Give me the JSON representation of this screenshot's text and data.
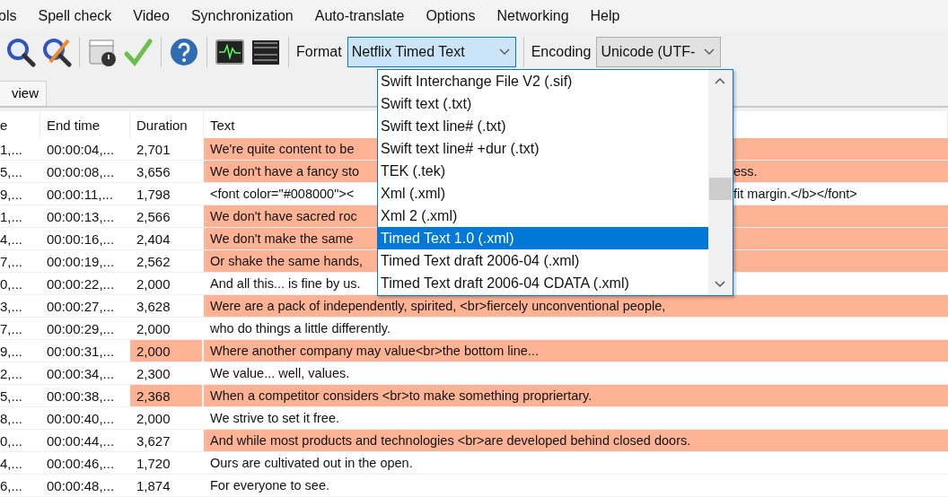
{
  "menu": [
    "ols",
    "Spell check",
    "Video",
    "Synchronization",
    "Auto-translate",
    "Options",
    "Networking",
    "Help"
  ],
  "toolbar": {
    "format_label": "Format",
    "format_value": "Netflix Timed Text",
    "encoding_label": "Encoding",
    "encoding_value": "Unicode (UTF-"
  },
  "tabs": [
    {
      "label": "view",
      "selected": true
    }
  ],
  "table": {
    "columns": [
      "e",
      "End time",
      "Duration",
      "Text"
    ],
    "rows": [
      {
        "start": "1,...",
        "end": "00:00:04,...",
        "duration": "2,701",
        "duration_flag": false,
        "text": "We're quite content to be",
        "text_continued": "",
        "flag": true
      },
      {
        "start": "5,...",
        "end": "00:00:08,...",
        "duration": "3,656",
        "duration_flag": false,
        "text": "We don't have a fancy sto",
        "text_continued": "ess.",
        "flag": true
      },
      {
        "start": "9,...",
        "end": "00:00:11,...",
        "duration": "1,798",
        "duration_flag": false,
        "text": "<font color=\"#008000\"><",
        "text_continued": "fit margin.</b></font>",
        "flag": false
      },
      {
        "start": "1,...",
        "end": "00:00:13,...",
        "duration": "2,566",
        "duration_flag": false,
        "text": "We don't have sacred roc",
        "text_continued": "",
        "flag": true
      },
      {
        "start": "4,...",
        "end": "00:00:16,...",
        "duration": "2,404",
        "duration_flag": false,
        "text": "We don't make the same",
        "text_continued": "",
        "flag": true
      },
      {
        "start": "7,...",
        "end": "00:00:19,...",
        "duration": "2,562",
        "duration_flag": false,
        "text": "Or shake the same hands,",
        "text_continued": "",
        "flag": true
      },
      {
        "start": "0,...",
        "end": "00:00:22,...",
        "duration": "2,000",
        "duration_flag": false,
        "text": "And all this... is fine by us.",
        "text_continued": "",
        "flag": false
      },
      {
        "start": "3,...",
        "end": "00:00:27,...",
        "duration": "3,628",
        "duration_flag": false,
        "text": "Were are a pack of independently, spirited, <br>fiercely unconventional people,",
        "text_continued": "",
        "flag": true
      },
      {
        "start": "7,...",
        "end": "00:00:29,...",
        "duration": "2,000",
        "duration_flag": false,
        "text": "who do things a little differently.",
        "text_continued": "",
        "flag": false
      },
      {
        "start": "9,...",
        "end": "00:00:31,...",
        "duration": "2,000",
        "duration_flag": true,
        "text": "Where another company may value<br>the bottom line...",
        "text_continued": "",
        "flag": true
      },
      {
        "start": "2,...",
        "end": "00:00:34,...",
        "duration": "2,300",
        "duration_flag": false,
        "text": "We value... well, values.",
        "text_continued": "",
        "flag": false
      },
      {
        "start": "5,...",
        "end": "00:00:38,...",
        "duration": "2,368",
        "duration_flag": true,
        "text": "When a competitor considers <br>to make something propriertary.",
        "text_continued": "",
        "flag": true
      },
      {
        "start": "8,...",
        "end": "00:00:40,...",
        "duration": "2,000",
        "duration_flag": false,
        "text": "We strive to set it free.",
        "text_continued": "",
        "flag": false
      },
      {
        "start": "0,...",
        "end": "00:00:44,...",
        "duration": "3,627",
        "duration_flag": false,
        "text": "And while most products and technologies <br>are developed behind closed doors.",
        "text_continued": "",
        "flag": true
      },
      {
        "start": "4,...",
        "end": "00:00:46,...",
        "duration": "1,720",
        "duration_flag": false,
        "text": "Ours are cultivated out in the open.",
        "text_continued": "",
        "flag": false
      },
      {
        "start": "6,...",
        "end": "00:00:48,...",
        "duration": "1,874",
        "duration_flag": false,
        "text": "For everyone to see.",
        "text_continued": "",
        "flag": false
      }
    ]
  },
  "format_dropdown": {
    "options": [
      {
        "label": "Swift Interchange File V2 (.sif)",
        "selected": false
      },
      {
        "label": "Swift text (.txt)",
        "selected": false
      },
      {
        "label": "Swift text line# (.txt)",
        "selected": false
      },
      {
        "label": "Swift text line# +dur (.txt)",
        "selected": false
      },
      {
        "label": "TEK (.tek)",
        "selected": false
      },
      {
        "label": "Xml (.xml)",
        "selected": false
      },
      {
        "label": "Xml 2 (.xml)",
        "selected": false
      },
      {
        "label": "Timed Text 1.0 (.xml)",
        "selected": true
      },
      {
        "label": "Timed Text draft 2006-04 (.xml)",
        "selected": false
      },
      {
        "label": "Timed Text draft 2006-04 CDATA (.xml)",
        "selected": false
      }
    ]
  }
}
